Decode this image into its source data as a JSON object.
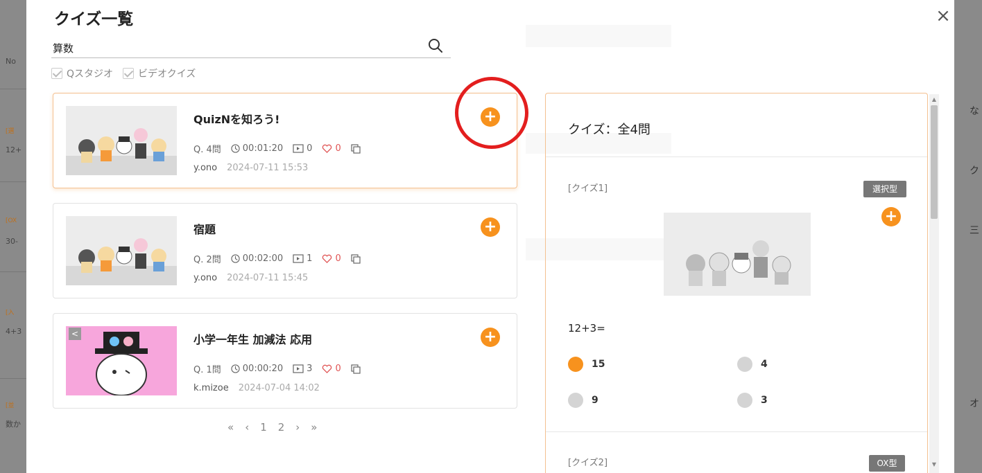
{
  "background": {
    "left_rows": [
      "No",
      "[選",
      "12+",
      "[OX",
      "30-",
      "[入",
      "4+3",
      "[並",
      "数か"
    ],
    "right_texts": [
      "な",
      "ク",
      "三",
      "オ"
    ]
  },
  "modal": {
    "title": "クイズ一覧",
    "close_symbol": "×"
  },
  "search": {
    "value": "算数",
    "placeholder": ""
  },
  "filters": [
    {
      "label": "Qスタジオ",
      "checked": true
    },
    {
      "label": "ビデオクイズ",
      "checked": true
    }
  ],
  "quizzes": [
    {
      "title": "QuizNを知ろう!",
      "questions": "Q. 4問",
      "duration": "00:01:20",
      "videos": "0",
      "likes": "0",
      "author": "y.ono",
      "date": "2024-07-11 15:53"
    },
    {
      "title": "宿題",
      "questions": "Q. 2問",
      "duration": "00:02:00",
      "videos": "1",
      "likes": "0",
      "author": "y.ono",
      "date": "2024-07-11 15:45"
    },
    {
      "title": "小学一年生 加減法 応用",
      "questions": "Q. 1問",
      "duration": "00:00:20",
      "videos": "3",
      "likes": "0",
      "author": "k.mizoe",
      "date": "2024-07-04 14:02"
    }
  ],
  "pagination": {
    "first": "«",
    "prev": "‹",
    "pages": [
      "1",
      "2"
    ],
    "next": "›",
    "last": "»"
  },
  "detail": {
    "title": "クイズ：全4問",
    "questions": [
      {
        "label": "[クイズ1]",
        "type": "選択型",
        "text": "12+3=",
        "choices": [
          {
            "text": "15",
            "correct": true
          },
          {
            "text": "4",
            "correct": false
          },
          {
            "text": "9",
            "correct": false
          },
          {
            "text": "3",
            "correct": false
          }
        ]
      },
      {
        "label": "[クイズ2]",
        "type": "OX型"
      }
    ]
  },
  "colors": {
    "accent": "#f7921e",
    "highlight_ring": "#e31e1e",
    "selected_border": "#f4c090",
    "like": "#e05555"
  },
  "icons": {
    "add": "+",
    "thumbnail_badge": "<"
  }
}
